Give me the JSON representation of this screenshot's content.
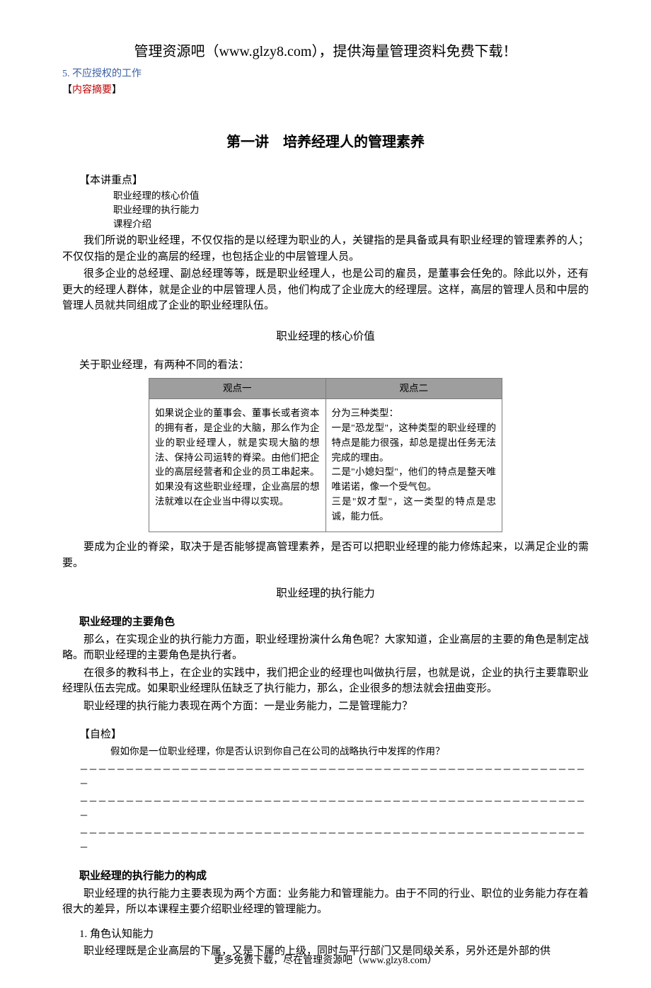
{
  "header": "管理资源吧（www.glzy8.com），提供海量管理资料免费下载！",
  "toc_item": "5. 不应授权的工作",
  "tag_open": "【",
  "tag_text": "内容摘要",
  "tag_close": "】",
  "lecture_title": "第一讲　培养经理人的管理素养",
  "keypoints_label": "【本讲重点】",
  "keypoints": [
    "职业经理的核心价值",
    "职业经理的执行能力",
    "课程介绍"
  ],
  "intro_paras": [
    "我们所说的职业经理，不仅仅指的是以经理为职业的人，关键指的是具备或具有职业经理的管理素养的人；不仅仅指的是企业的高层的经理，也包括企业的中层管理人员。",
    "很多企业的总经理、副总经理等等，既是职业经理人，也是公司的雇员，是董事会任免的。除此以外，还有更大的经理人群体，就是企业的中层管理人员，他们构成了企业庞大的经理层。这样，高层的管理人员和中层的管理人员就共同组成了企业的职业经理队伍。"
  ],
  "section1_title": "职业经理的核心价值",
  "section1_intro": "关于职业经理，有两种不同的看法：",
  "table": {
    "headers": [
      "观点一",
      "观点二"
    ],
    "col1": "如果说企业的董事会、董事长或者资本的拥有者，是企业的大脑，那么作为企业的职业经理人，就是实现大脑的想法、保持公司运转的脊梁。由他们把企业的高层经营者和企业的员工串起来。如果没有这些职业经理，企业高层的想法就难以在企业当中得以实现。",
    "col2": "分为三种类型：\n一是\"恐龙型\"，这种类型的职业经理的特点是能力很强，却总是提出任务无法完成的理由。\n二是\"小媳妇型\"，他们的特点是整天唯唯诺诺，像一个受气包。\n三是\"奴才型\"，这一类型的特点是忠诚，能力低。"
  },
  "section1_conclusion": "要成为企业的脊梁，取决于是否能够提高管理素养，是否可以把职业经理的能力修炼起来，以满足企业的需要。",
  "section2_title": "职业经理的执行能力",
  "sub1_heading": "职业经理的主要角色",
  "sub1_paras": [
    "那么，在实现企业的执行能力方面，职业经理扮演什么角色呢？大家知道，企业高层的主要的角色是制定战略。而职业经理的主要角色是执行者。",
    "在很多的教科书上，在企业的实践中，我们把企业的经理也叫做执行层，也就是说，企业的执行主要靠职业经理队伍去完成。如果职业经理队伍缺乏了执行能力，那么，企业很多的想法就会扭曲变形。",
    "职业经理的执行能力表现在两个方面：一是业务能力，二是管理能力？"
  ],
  "self_check_label": "【自检】",
  "self_check_body": "假如你是一位职业经理，你是否认识到你自己在公司的战略执行中发挥的作用？",
  "dash_line": "－－－－－－－－－－－－－－－－－－－－－－－－－－－－－－－－－－－－－－－－－－－－－－－－－－－－－－－－",
  "sub2_heading": "职业经理的执行能力的构成",
  "sub2_paras": [
    "职业经理的执行能力主要表现为两个方面：业务能力和管理能力。由于不同的行业、职位的业务能力存在着很大的差异，所以本课程主要介绍职业经理的管理能力。"
  ],
  "num_heading": "1. 角色认知能力",
  "num_para": "职业经理既是企业高层的下属，又是下属的上级，同时与平行部门又是同级关系，另外还是外部的供",
  "footer": "更多免费下载，尽在管理资源吧（www.glzy8.com）"
}
